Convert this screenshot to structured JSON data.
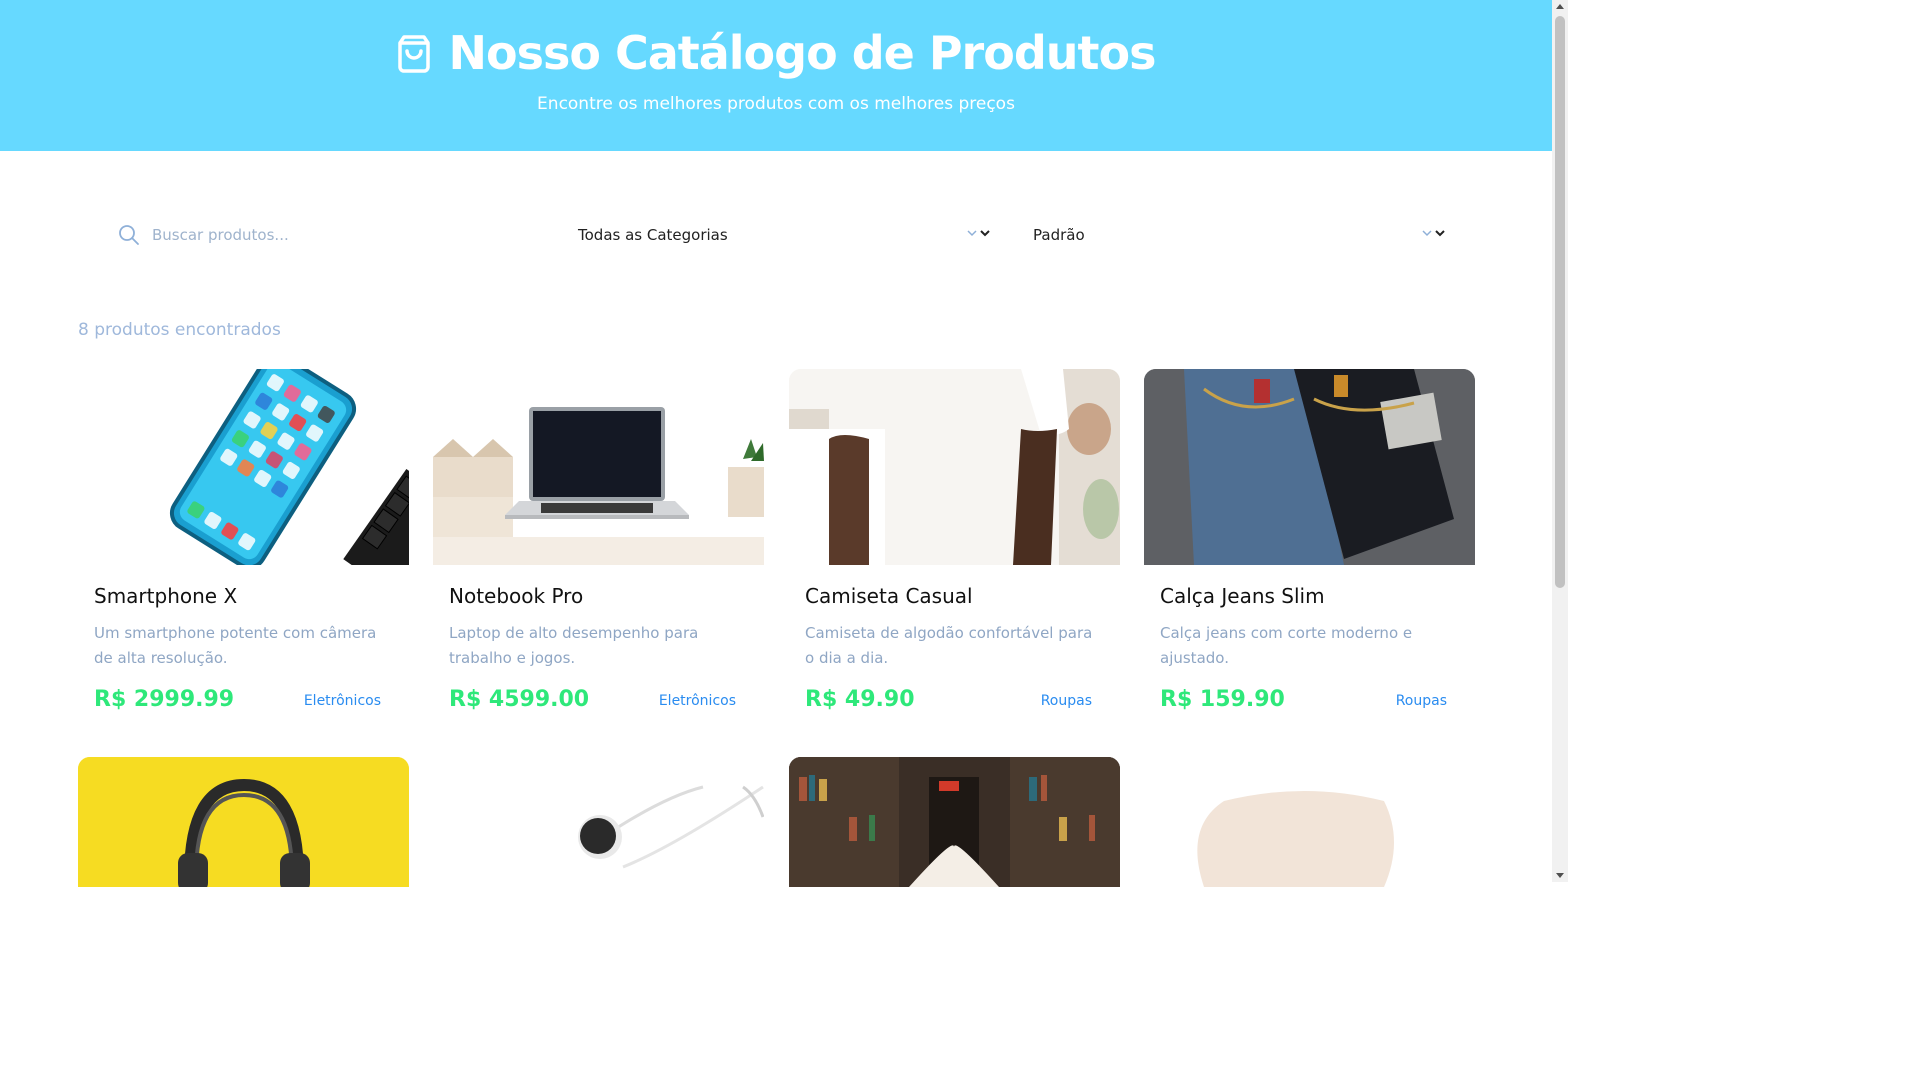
{
  "header": {
    "title": "Nosso Catálogo de Produtos",
    "subtitle": "Encontre os melhores produtos com os melhores preços",
    "icon": "shopping-bag-icon",
    "background": "#66d9ff"
  },
  "filters": {
    "search_placeholder": "Buscar produtos...",
    "category_selected": "Todas as Categorias",
    "sort_selected": "Padrão"
  },
  "results": {
    "count_text": "8 produtos encontrados"
  },
  "products": [
    {
      "name": "Smartphone X",
      "description": "Um smartphone potente com câmera de alta resolução.",
      "price": "R$ 2999.99",
      "category": "Eletrônicos",
      "image": "smartphone-image"
    },
    {
      "name": "Notebook Pro",
      "description": "Laptop de alto desempenho para trabalho e jogos.",
      "price": "R$ 4599.00",
      "category": "Eletrônicos",
      "image": "laptop-image"
    },
    {
      "name": "Camiseta Casual",
      "description": "Camiseta de algodão confortável para o dia a dia.",
      "price": "R$ 49.90",
      "category": "Roupas",
      "image": "tshirt-image"
    },
    {
      "name": "Calça Jeans Slim",
      "description": "Calça jeans com corte moderno e ajustado.",
      "price": "R$ 159.90",
      "category": "Roupas",
      "image": "jeans-image"
    }
  ],
  "products_row2_images": [
    "headphones-image",
    "earphones-image",
    "books-image",
    "fabric-image"
  ],
  "colors": {
    "price": "#2ee87a",
    "category": "#2a8cf0",
    "muted": "#8fa6c4"
  }
}
